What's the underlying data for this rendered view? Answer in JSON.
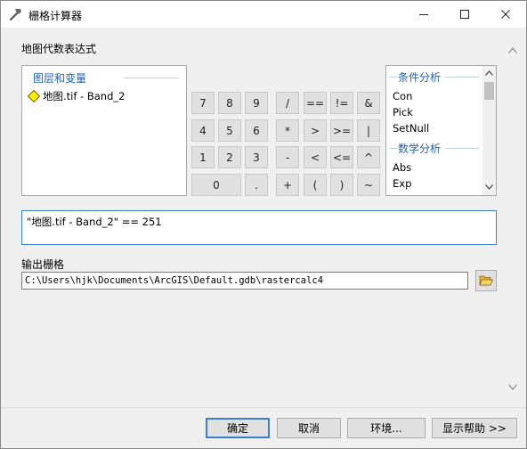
{
  "window": {
    "title": "栅格计算器",
    "minimize_glyph": "—",
    "maximize_glyph": "☐",
    "close_glyph": "✕"
  },
  "expression_section": {
    "label": "地图代数表达式"
  },
  "layers_panel": {
    "title": "图层和变量",
    "items": [
      {
        "label": "地图.tif - Band_2",
        "icon": "raster-diamond-icon"
      }
    ]
  },
  "calculator": {
    "buttons": [
      [
        "7",
        "8",
        "9",
        "/",
        "==",
        "!=",
        "&"
      ],
      [
        "4",
        "5",
        "6",
        "*",
        ">",
        ">=",
        "|"
      ],
      [
        "1",
        "2",
        "3",
        "-",
        "<",
        "<=",
        "^"
      ],
      [
        "0",
        ".",
        "+",
        "(",
        ")",
        "~"
      ]
    ]
  },
  "tools_panel": {
    "group1_title": "条件分析",
    "group1_items": [
      "Con",
      "Pick",
      "SetNull"
    ],
    "group2_title": "数学分析",
    "group2_items": [
      "Abs",
      "Exp"
    ]
  },
  "expression": {
    "value": "\"地图.tif - Band_2\" == 251"
  },
  "output": {
    "label": "输出栅格",
    "path": "C:\\Users\\hjk\\Documents\\ArcGIS\\Default.gdb\\rastercalc4",
    "browse_icon": "folder-open-icon"
  },
  "footer": {
    "ok_label": "确定",
    "cancel_label": "取消",
    "env_label": "环境...",
    "help_label": "显示帮助 >>"
  },
  "colors": {
    "accent": "#1f63b4",
    "primary_button_border": "#3c7fd1",
    "dialog_bg": "#f0f0f0"
  }
}
